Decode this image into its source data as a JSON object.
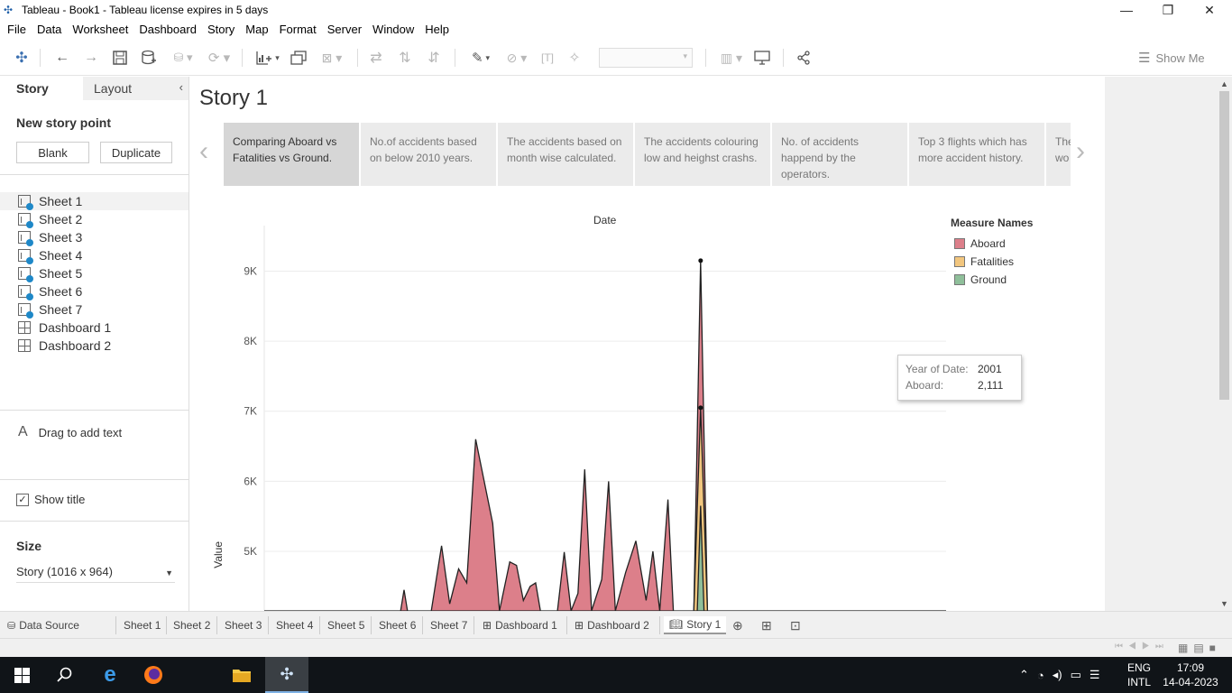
{
  "window": {
    "title": "Tableau - Book1 - Tableau license expires in 5 days",
    "minimize": "—",
    "restore": "❐",
    "close": "✕"
  },
  "menu": [
    "File",
    "Data",
    "Worksheet",
    "Dashboard",
    "Story",
    "Map",
    "Format",
    "Server",
    "Window",
    "Help"
  ],
  "toolbar": {
    "show_me": "Show Me"
  },
  "left_pane": {
    "tab_story": "Story",
    "tab_layout": "Layout",
    "collapse": "‹",
    "new_story_point": "New story point",
    "blank_button": "Blank",
    "duplicate_button": "Duplicate",
    "sheets": [
      "Sheet 1",
      "Sheet 2",
      "Sheet 3",
      "Sheet 4",
      "Sheet 5",
      "Sheet 6",
      "Sheet 7"
    ],
    "dashboards": [
      "Dashboard 1",
      "Dashboard 2"
    ],
    "drag_text": "Drag to add text",
    "drag_icon": "A",
    "show_title_label": "Show title",
    "show_title_checked": "✓",
    "size_label": "Size",
    "size_value": "Story (1016 x 964)"
  },
  "story": {
    "title": "Story 1",
    "points": [
      "Comparing Aboard vs Fatalities vs Ground.",
      "No.of accidents based on below 2010 years.",
      "The accidents based on month wise calculated.",
      "The accidents colouring low and heighst crashs.",
      "No. of accidents happend by the operators.",
      "Top 3 flights which has more accident history.",
      "The wo"
    ]
  },
  "chart_data": {
    "type": "area",
    "title": "Date",
    "ylabel": "Value",
    "y_ticks": [
      "5K",
      "6K",
      "7K",
      "8K",
      "9K"
    ],
    "ylim": [
      4150,
      9650
    ],
    "series": [
      {
        "name": "Aboard",
        "color": "#dc7f8a",
        "values": [
          [
            0.0,
            4150
          ],
          [
            0.2,
            4150
          ],
          [
            0.205,
            4450
          ],
          [
            0.21,
            4150
          ],
          [
            0.245,
            4150
          ],
          [
            0.26,
            5080
          ],
          [
            0.272,
            4250
          ],
          [
            0.285,
            4750
          ],
          [
            0.297,
            4550
          ],
          [
            0.31,
            6600
          ],
          [
            0.335,
            5400
          ],
          [
            0.345,
            4150
          ],
          [
            0.36,
            4850
          ],
          [
            0.37,
            4800
          ],
          [
            0.38,
            4300
          ],
          [
            0.39,
            4500
          ],
          [
            0.398,
            4550
          ],
          [
            0.405,
            4150
          ],
          [
            0.43,
            4150
          ],
          [
            0.44,
            4990
          ],
          [
            0.45,
            4150
          ],
          [
            0.46,
            4400
          ],
          [
            0.47,
            6170
          ],
          [
            0.48,
            4150
          ],
          [
            0.495,
            4600
          ],
          [
            0.505,
            6000
          ],
          [
            0.515,
            4150
          ],
          [
            0.53,
            4700
          ],
          [
            0.545,
            5150
          ],
          [
            0.56,
            4300
          ],
          [
            0.57,
            5000
          ],
          [
            0.58,
            4150
          ],
          [
            0.592,
            5740
          ],
          [
            0.6,
            4150
          ],
          [
            0.63,
            4150
          ],
          [
            0.64,
            9150
          ],
          [
            0.65,
            4150
          ],
          [
            1.0,
            4150
          ]
        ]
      },
      {
        "name": "Fatalities",
        "color": "#f2c67e",
        "values": [
          [
            0.63,
            4150
          ],
          [
            0.64,
            7050
          ],
          [
            0.65,
            4150
          ]
        ]
      },
      {
        "name": "Ground",
        "color": "#8fbf9a",
        "values": [
          [
            0.635,
            4150
          ],
          [
            0.64,
            5650
          ],
          [
            0.645,
            4150
          ]
        ]
      }
    ]
  },
  "legend": {
    "title": "Measure Names",
    "items": [
      {
        "label": "Aboard",
        "color": "#dc7f8a"
      },
      {
        "label": "Fatalities",
        "color": "#f2c67e"
      },
      {
        "label": "Ground",
        "color": "#8fbf9a"
      }
    ]
  },
  "tooltip": {
    "year_label": "Year of Date:",
    "year_value": "2001",
    "aboard_label": "Aboard:",
    "aboard_value": "2,111"
  },
  "sheet_tabs": {
    "data_source": "Data Source",
    "tabs": [
      "Sheet 1",
      "Sheet 2",
      "Sheet 3",
      "Sheet 4",
      "Sheet 5",
      "Sheet 6",
      "Sheet 7",
      "Dashboard 1",
      "Dashboard 2",
      "Story 1"
    ]
  },
  "taskbar": {
    "lang_top": "ENG",
    "lang_bottom": "INTL",
    "time": "17:09",
    "date": "14-04-2023"
  }
}
